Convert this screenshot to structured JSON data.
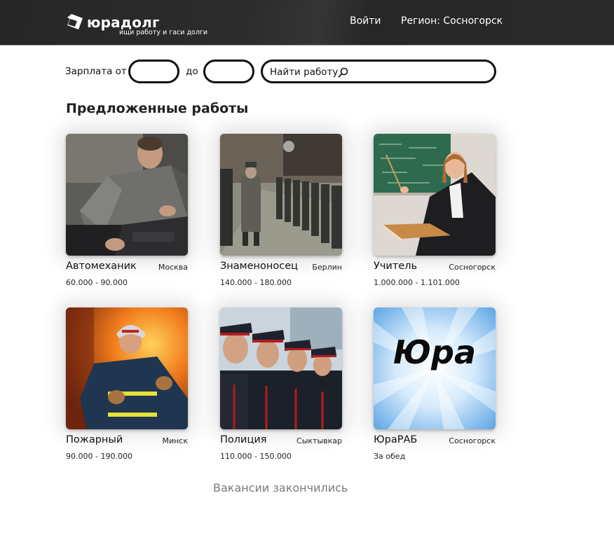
{
  "header": {
    "logo_text": "юрадолг",
    "tagline": "ищи работу и гаси долги",
    "login_label": "Войти",
    "region_label": "Регион: Сосногорск"
  },
  "filters": {
    "salary_from_label": "Зарплата от",
    "salary_from_value": "",
    "salary_to_label": "до",
    "salary_to_value": "",
    "search_placeholder": "Найти работу"
  },
  "main": {
    "section_title": "Предложенные работы",
    "jobs": [
      {
        "title": "Автомеханик",
        "city": "Москва",
        "salary": "60.000 - 90.000",
        "image": "mechanic-photo"
      },
      {
        "title": "Знаменоносец",
        "city": "Берлин",
        "salary": "140.000 - 180.000",
        "image": "parade-photo"
      },
      {
        "title": "Учитель",
        "city": "Сосногорск",
        "salary": "1.000.000 - 1.101.000",
        "image": "teacher-photo"
      },
      {
        "title": "Пожарный",
        "city": "Минск",
        "salary": "90.000 - 190.000",
        "image": "firefighter-photo"
      },
      {
        "title": "Полиция",
        "city": "Сыктывкар",
        "salary": "110.000 - 150.000",
        "image": "police-photo"
      },
      {
        "title": "ЮраРАБ",
        "city": "Сосногорск",
        "salary": "За обед",
        "image": "yura-logo-image",
        "image_text": "Юра"
      }
    ],
    "end_note": "Вакансии закончились"
  },
  "colors": {
    "header_bg": "#2a2a2a",
    "text": "#111111",
    "muted": "#7a7a7a",
    "field_border": "#111111"
  }
}
